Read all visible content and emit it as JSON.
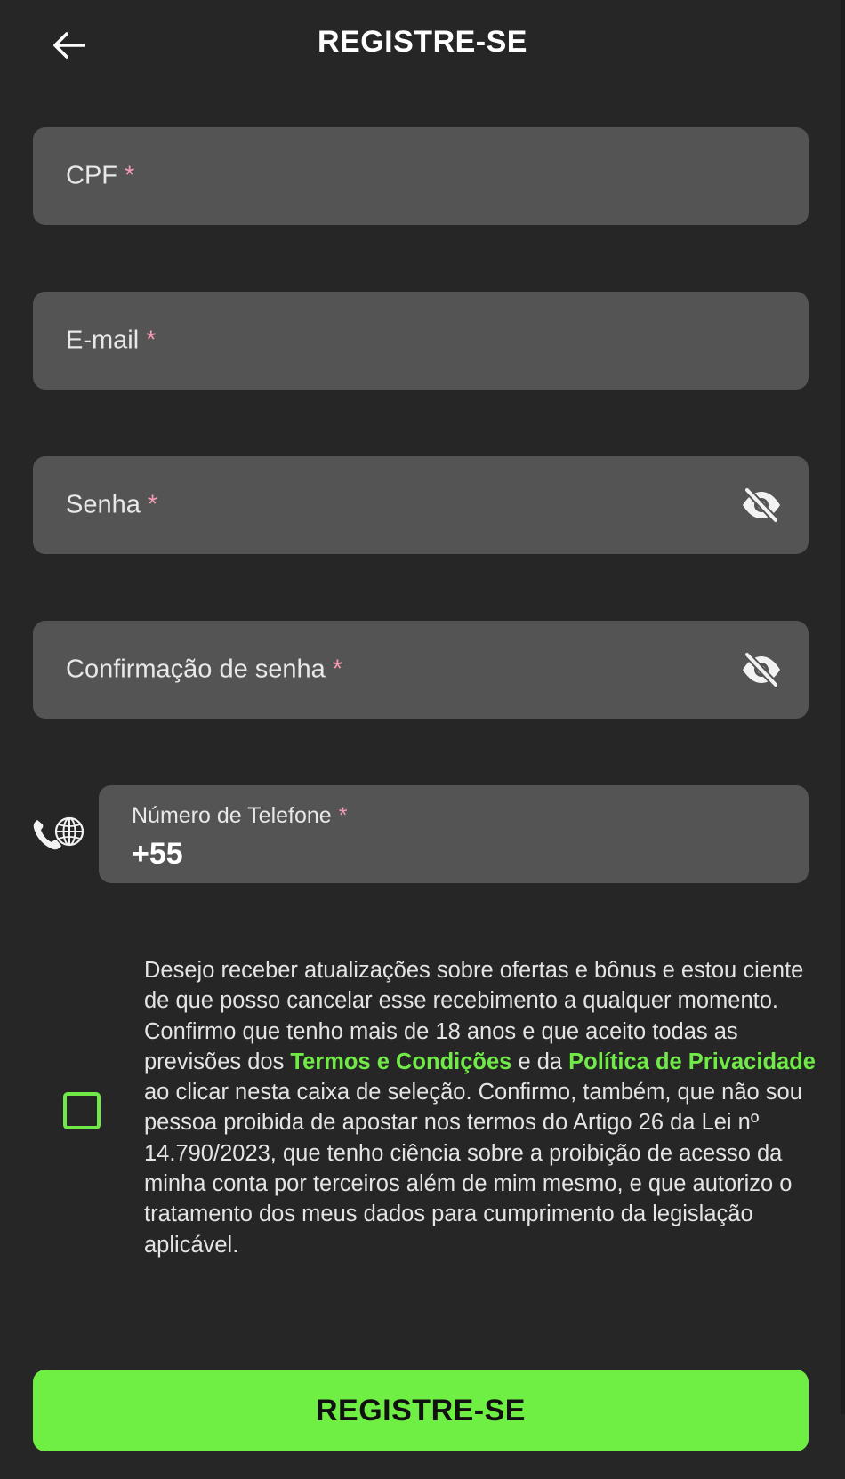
{
  "header": {
    "back_icon": "arrow-left-icon",
    "title": "REGISTRE-SE"
  },
  "form": {
    "cpf": {
      "label": "CPF",
      "required_mark": "*",
      "value": ""
    },
    "email": {
      "label": "E-mail",
      "required_mark": "*",
      "value": ""
    },
    "password": {
      "label": "Senha",
      "required_mark": "*",
      "value": "",
      "toggle_icon": "eye-off-icon"
    },
    "password_confirm": {
      "label": "Confirmação de senha",
      "required_mark": "*",
      "value": "",
      "toggle_icon": "eye-off-icon"
    },
    "phone": {
      "icon": "phone-globe-icon",
      "label": "Número de Telefone",
      "required_mark": "*",
      "value": "+55"
    }
  },
  "consent": {
    "checked": false,
    "text_1": "Desejo receber atualizações sobre ofertas e bônus e estou ciente de que posso cancelar esse recebimento a qualquer momento. Confirmo que tenho mais de 18 anos e que aceito todas as previsões dos ",
    "terms_link": "Termos e Condições",
    "text_2": " e da ",
    "privacy_link": "Política de Privacidade",
    "text_3": " ao clicar nesta caixa de seleção. Confirmo, também, que não sou pessoa proibida de apostar nos termos do Artigo 26 da Lei nº 14.790/2023, que tenho ciência sobre a proibição de acesso da minha conta por terceiros além de mim mesmo, e que autorizo o tratamento dos meus dados para cumprimento da legislação aplicável."
  },
  "submit": {
    "label": "REGISTRE-SE"
  },
  "colors": {
    "background": "#262626",
    "field": "#545454",
    "accent": "#6fef44",
    "required": "#f29bb3"
  }
}
